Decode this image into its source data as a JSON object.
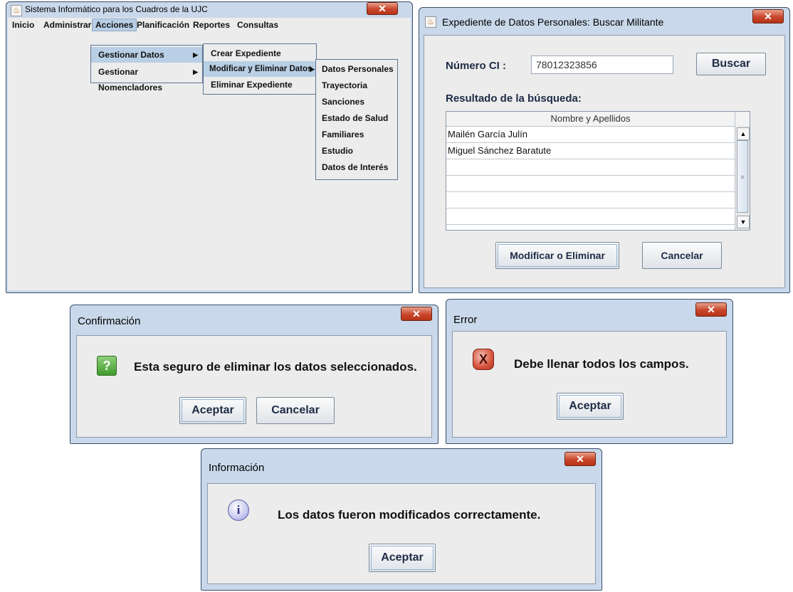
{
  "main_window": {
    "title": "Sistema Informático para los  Cuadros de la  UJC",
    "menus": [
      "Inicio",
      "Administrar",
      "Acciones",
      "Planificación",
      "Reportes",
      "Consultas"
    ],
    "acciones_menu": [
      "Gestionar Datos",
      "Gestionar Nomencladores"
    ],
    "gestionar_datos_menu": [
      "Crear Expediente",
      "Modificar y Eliminar Datos",
      "Eliminar Expediente"
    ],
    "modificar_menu": [
      "Datos Personales",
      "Trayectoria",
      "Sanciones",
      "Estado de Salud",
      "Familiares",
      "Estudio",
      "Datos de Interés"
    ]
  },
  "search_window": {
    "title": "Expediente de Datos Personales: Buscar Militante",
    "ci_label": "Número  CI :",
    "ci_value": "78012323856",
    "search_button": "Buscar",
    "results_label": "Resultado de la búsqueda:",
    "table_header": "Nombre y Apellidos",
    "rows": [
      "Mailén García Julín",
      "Miguel Sánchez Baratute",
      "",
      "",
      "",
      ""
    ],
    "modify_button": "Modificar o Eliminar",
    "cancel_button": "Cancelar"
  },
  "confirm_dialog": {
    "title": "Confirmación",
    "icon": "question-icon",
    "message": "Esta seguro de eliminar los datos seleccionados.",
    "accept_button": "Aceptar",
    "cancel_button": "Cancelar"
  },
  "error_dialog": {
    "title": "Error",
    "icon": "error-icon",
    "message": "Debe llenar todos los campos.",
    "accept_button": "Aceptar"
  },
  "info_dialog": {
    "title": "Información",
    "icon": "info-icon",
    "message": "Los datos fueron modificados correctamente.",
    "accept_button": "Aceptar"
  }
}
